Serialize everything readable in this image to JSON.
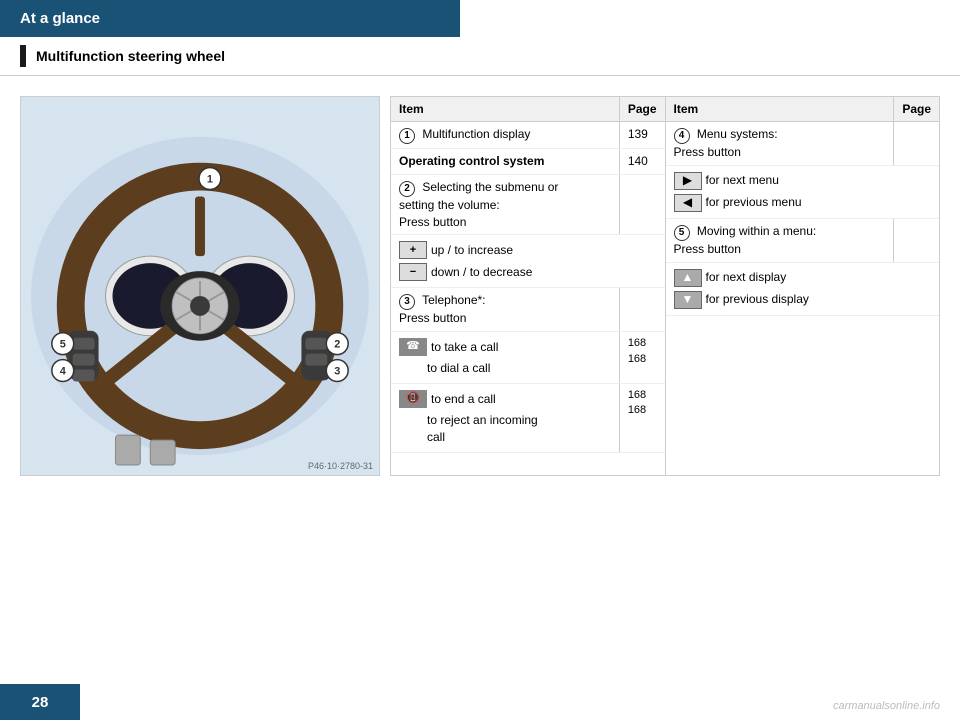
{
  "header": {
    "title": "At a glance",
    "subheader": "Multifunction steering wheel",
    "background_color": "#1a5276"
  },
  "table_left": {
    "col_item": "Item",
    "col_page": "Page",
    "rows": [
      {
        "num": "1",
        "label": "Multifunction display",
        "page": "139"
      },
      {
        "num": null,
        "label": "Operating control system",
        "label_bold": true,
        "page": "140"
      },
      {
        "num": "2",
        "label": "Selecting the submenu or\nsetting the volume:\nPress button",
        "page": ""
      },
      {
        "num": null,
        "sub": [
          {
            "icon": "+",
            "text": "up / to increase"
          },
          {
            "icon": "−",
            "text": "down / to decrease"
          }
        ]
      },
      {
        "num": "3",
        "label": "Telephone*:\nPress button",
        "page": ""
      },
      {
        "num": null,
        "sub": [
          {
            "icon": "phone_pick",
            "text": "to take a call",
            "page": "168"
          },
          {
            "icon": null,
            "text": "to dial a call",
            "page": "168"
          }
        ]
      },
      {
        "num": null,
        "sub": [
          {
            "icon": "phone_end",
            "text": "to end a call",
            "page": "168"
          },
          {
            "icon": null,
            "text": "to reject an incoming call",
            "page": "168"
          }
        ]
      }
    ]
  },
  "table_right": {
    "col_item": "Item",
    "col_page": "Page",
    "rows": [
      {
        "num": "4",
        "label": "Menu systems:\nPress button",
        "page": ""
      },
      {
        "num": null,
        "sub": [
          {
            "icon": "arrow_right",
            "text": "for next menu"
          },
          {
            "icon": "arrow_left",
            "text": "for previous menu"
          }
        ]
      },
      {
        "num": "5",
        "label": "Moving within a menu:\nPress button",
        "page": ""
      },
      {
        "num": null,
        "sub": [
          {
            "icon": "triangle_up",
            "text": "for next display"
          },
          {
            "icon": "triangle_down",
            "text": "for previous display"
          }
        ]
      }
    ]
  },
  "footer": {
    "page_number": "28"
  },
  "photo_credit": "P46·10·2780-31",
  "watermark": "carmanualsonline.info"
}
